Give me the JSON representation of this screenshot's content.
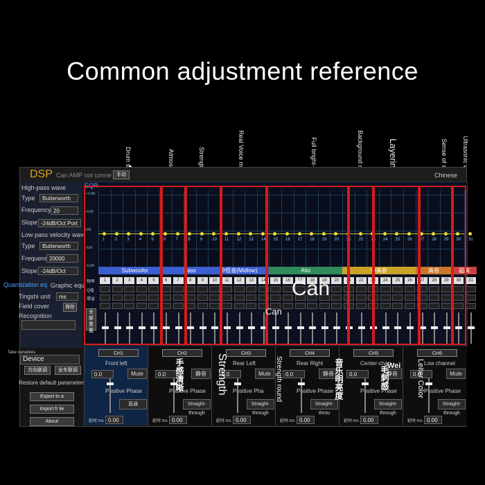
{
  "heading": "Common adjustment reference",
  "callouts": {
    "drum": "Drum s",
    "atmosphere": "Atmos",
    "strength_top": "Strength",
    "real_voice": "Real Voice mal instrument",
    "full_brightness": "Full bright-ness",
    "background": "Background mu",
    "layering": "Layering",
    "sense_of_space": "Sense of space",
    "ultrasonic": "Ultrasonic wave"
  },
  "titlebar": {
    "logo": "DSP",
    "status": "Can AMP not conne",
    "small_btn": "手动",
    "chinese": "Chinese"
  },
  "sidebar": {
    "highpass_heading": "High-pass wave",
    "type_label": "Type",
    "type_value": "Butterworth",
    "frequency_label": "Frequency",
    "frequency_value": "20",
    "slope_label": "Slope",
    "slope_value": "-24dB/Oct Port",
    "lowpass_heading": "Low pass velocity wave",
    "lp_type_label": "Type",
    "lp_type_value": "Butterworth",
    "lp_frequency_label": "Frequency",
    "lp_frequency_value": "20000",
    "lp_slope_label": "Slope",
    "lp_slope_value": "-24dB/Oct",
    "quantization": "Quantization eq",
    "graphic_eq": "Graphic equ",
    "tingshi_label": "Tingshi unit",
    "tingshi_value": "ms",
    "field_cover_label": "Field cover",
    "field_cover_btn": "保存",
    "recognition_label": "Recognition",
    "take_label": "Take ourselves",
    "device_label": "Device",
    "btn_direction": "方向联调",
    "btn_all": "全车联调",
    "restore": "Restore default parameters",
    "export": "Export to a",
    "import": "Import fr ile",
    "about": "About"
  },
  "eq": {
    "tag": "EQR",
    "y_ticks": [
      "+12dB",
      "+6dB",
      "0dB",
      "-6dB",
      "-12dB"
    ],
    "bands": [
      {
        "name": "Subwoofer",
        "color": "#3b5fd0"
      },
      {
        "name": "Bass",
        "color": "#3b5fd0"
      },
      {
        "name": "中低音(Midlow)",
        "color": "#3b5fd0"
      },
      {
        "name": "Alto",
        "color": "#2f8c5a"
      },
      {
        "name": "中高音",
        "color": "#c9a227"
      },
      {
        "name": "高音",
        "color": "#c9762a"
      },
      {
        "name": "超高",
        "color": "#cc4040"
      }
    ],
    "row_labels": [
      "频率",
      "Q值",
      "增益"
    ],
    "reset_btn": "全部重置",
    "channel_numbers": [
      "1",
      "2",
      "3",
      "4",
      "5",
      "6",
      "7",
      "8",
      "9",
      "10",
      "11",
      "12",
      "13",
      "14",
      "15",
      "16",
      "17",
      "18",
      "19",
      "20",
      "21",
      "22",
      "23",
      "24",
      "25",
      "26",
      "27",
      "28",
      "29",
      "30",
      "31"
    ]
  },
  "overlay": {
    "can_big": "Can",
    "can_small": "Can"
  },
  "channels": [
    {
      "tab": "CH1",
      "position": "Front left",
      "value": "0.0",
      "mute": "Mute",
      "phase": "Positive Phase",
      "mode": "直通",
      "delay_label": "延时:ms",
      "delay": "0.00"
    },
    {
      "tab": "CH2",
      "position": "",
      "value": "0.0",
      "mute": "静音",
      "phase": "Positive Phase",
      "mode": "Straight-through",
      "delay_label": "延时:ms",
      "delay": "0.00"
    },
    {
      "tab": "CH3",
      "position": "Rear Left",
      "value": "0.0",
      "mute": "Mute",
      "phase": "Positive Pha",
      "mode": "Straight-through",
      "delay_label": "延时:ms",
      "delay": "0.00"
    },
    {
      "tab": "CH4",
      "position": "Rear Right",
      "value": "0.0",
      "mute": "静音",
      "phase": "Positive Phase",
      "mode": "Straight-throu",
      "delay_label": "延时:ms",
      "delay": "0.00"
    },
    {
      "tab": "CH5",
      "position": "Center-chan",
      "value": "0.0",
      "mute": "静音",
      "phase": "Positive Phase",
      "mode": "Straight-through",
      "delay_label": "延时:ms",
      "delay": "0.00"
    },
    {
      "tab": "CH6",
      "position": "Low channel",
      "value": "0.0",
      "mute": "Mute",
      "phase": "Positive Phase",
      "mode": "Straight-through",
      "delay_label": "延时:ms",
      "delay": "0.00"
    }
  ],
  "channel_overlays": {
    "ch2_big": "手感清晰",
    "strength": "Strength",
    "strength_round": "Strength round",
    "ch4_big": "音乐明亮度",
    "wei": "Wei",
    "ch5_big": "毛刺感",
    "leiter": "Leiter Color"
  }
}
